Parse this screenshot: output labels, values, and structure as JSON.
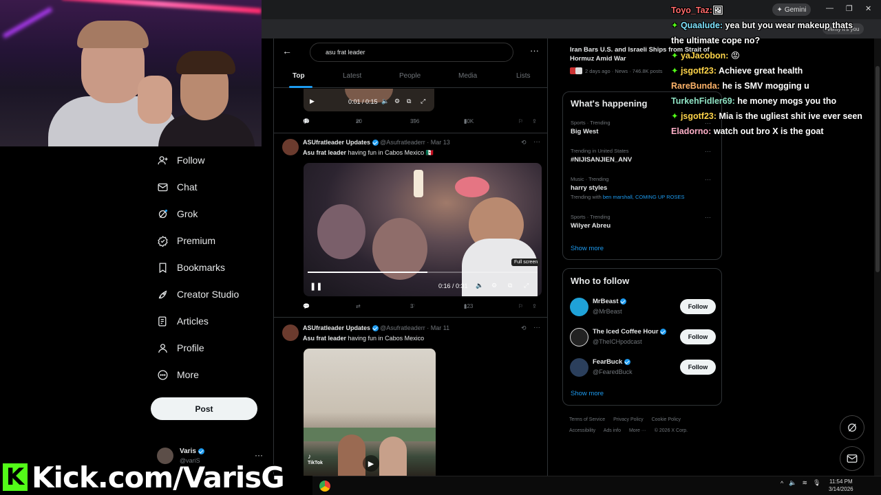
{
  "browser": {
    "gemini_label": "Gemini",
    "profile_label": "Verify it's you"
  },
  "nav": {
    "items": [
      {
        "label": "Follow",
        "icon": "follow-icon"
      },
      {
        "label": "Chat",
        "icon": "chat-icon"
      },
      {
        "label": "Grok",
        "icon": "grok-icon"
      },
      {
        "label": "Premium",
        "icon": "premium-icon"
      },
      {
        "label": "Bookmarks",
        "icon": "bookmark-icon"
      },
      {
        "label": "Creator Studio",
        "icon": "rocket-icon"
      },
      {
        "label": "Articles",
        "icon": "articles-icon"
      },
      {
        "label": "Profile",
        "icon": "person-icon"
      },
      {
        "label": "More",
        "icon": "more-icon"
      }
    ],
    "post_label": "Post",
    "account_name": "Varis",
    "account_handle": "@variS"
  },
  "overlay": {
    "kick_logo": "K",
    "kick_text": "Kick.com/VarisG"
  },
  "search": {
    "query": "asu frat leader"
  },
  "tabs": [
    "Top",
    "Latest",
    "People",
    "Media",
    "Lists"
  ],
  "tweet0": {
    "video_time": "0:01 / 0:15",
    "replies": "12",
    "reposts": "20",
    "likes": "396",
    "views": "30K"
  },
  "tweet1": {
    "name": "ASUfratleader Updates",
    "handle": "@Asufratleaderr",
    "date": "· Mar 13",
    "text_bold": "Asu frat leader",
    "text_rest": " having fun in Cabos Mexico 🇲🇽",
    "video_time": "0:16 / 0:31",
    "tooltip": "Full screen",
    "replies": "",
    "reposts": "",
    "likes": "3",
    "views": "123"
  },
  "tweet2": {
    "name": "ASUfratleader Updates",
    "handle": "@Asufratleaderr",
    "date": "· Mar 11",
    "text_bold": "Asu frat leader",
    "text_rest": " having fun in Cabos Mexico",
    "tiktok_label": "TikTok"
  },
  "news": {
    "title": "Iran Bars U.S. and Israeli Ships from Strait of Hormuz Amid War",
    "meta": "2 days ago · News · 746.8K posts"
  },
  "happening": {
    "title": "What's happening",
    "trends": [
      {
        "category": "Sports · Trending",
        "title": "Big West",
        "with": ""
      },
      {
        "category": "Trending in United States",
        "title": "#NIJISANJIEN_ANV",
        "with": ""
      },
      {
        "category": "Music · Trending",
        "title": "harry styles",
        "with_prefix": "Trending with",
        "with": "ben marshall, COMING UP ROSES"
      },
      {
        "category": "Sports · Trending",
        "title": "Wilyer Abreu",
        "with": ""
      }
    ],
    "show_more": "Show more"
  },
  "who_to_follow": {
    "title": "Who to follow",
    "accounts": [
      {
        "name": "MrBeast",
        "handle": "@MrBeast",
        "button": "Follow",
        "color": "#1fa2d8"
      },
      {
        "name": "The Iced Coffee Hour",
        "handle": "@TheICHpodcast",
        "button": "Follow",
        "color": "#222222"
      },
      {
        "name": "FearBuck",
        "handle": "@FearedBuck",
        "button": "Follow",
        "color": "#2b3f5c"
      }
    ],
    "show_more": "Show more"
  },
  "footer": {
    "links": [
      "Terms of Service",
      "Privacy Policy",
      "Cookie Policy",
      "Accessibility",
      "Ads info",
      "More ···",
      "© 2026 X Corp."
    ]
  },
  "chat": [
    {
      "user": "Toyo_Taz:",
      "color": "#ff6a6a",
      "star": false,
      "text": "🖼"
    },
    {
      "user": "Quaalude:",
      "color": "#7fe3ff",
      "star": true,
      "text": " yea but you wear makeup thats"
    },
    {
      "user": "",
      "color": "#ffffff",
      "star": false,
      "text": "the ultimate cope no?"
    },
    {
      "user": "yaJacobon:",
      "color": "#ffd54a",
      "star": true,
      "text": " 😡"
    },
    {
      "user": "jsgotf23:",
      "color": "#ffd54a",
      "star": true,
      "text": " Achieve great health"
    },
    {
      "user": "RareBunda:",
      "color": "#ffb46a",
      "star": false,
      "text": " he is SMV mogging u"
    },
    {
      "user": "TurkehFidler69:",
      "color": "#8fe3c4",
      "star": false,
      "text": " he money mogs you tho"
    },
    {
      "user": "jsgotf23:",
      "color": "#ffd54a",
      "star": true,
      "text": " Mia is the ugliest shit ive ever seen"
    },
    {
      "user": "Eladorno:",
      "color": "#ffb0c8",
      "star": false,
      "text": " watch out bro X is the goat"
    }
  ],
  "taskbar": {
    "time": "11:54 PM",
    "date": "3/14/2026"
  }
}
